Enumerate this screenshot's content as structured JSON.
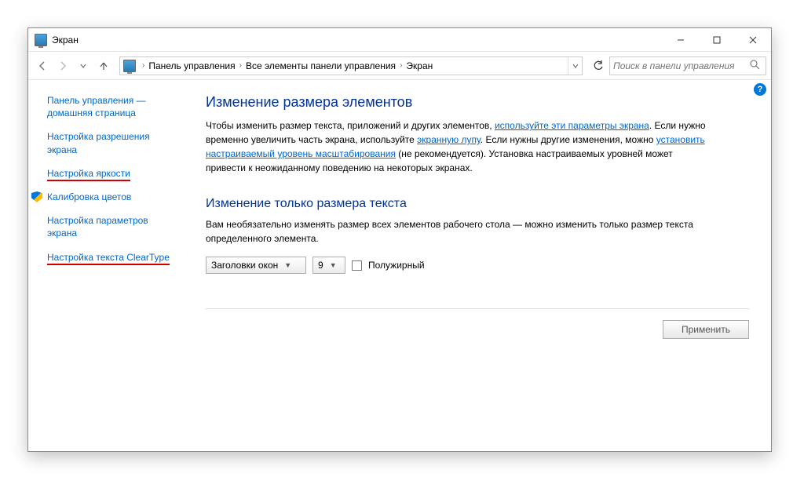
{
  "window": {
    "title": "Экран"
  },
  "breadcrumb": {
    "items": [
      "Панель управления",
      "Все элементы панели управления",
      "Экран"
    ]
  },
  "search": {
    "placeholder": "Поиск в панели управления"
  },
  "sidebar": {
    "home": "Панель управления — домашняя страница",
    "items": [
      {
        "label": "Настройка разрешения экрана",
        "underline": false,
        "shield": false
      },
      {
        "label": "Настройка яркости",
        "underline": true,
        "shield": false
      },
      {
        "label": "Калибровка цветов",
        "underline": false,
        "shield": true
      },
      {
        "label": "Настройка параметров экрана",
        "underline": false,
        "shield": false
      },
      {
        "label": "Настройка текста ClearType",
        "underline": true,
        "shield": false
      }
    ]
  },
  "main": {
    "heading1": "Изменение размера элементов",
    "p1_a": "Чтобы изменить размер текста, приложений и других элементов, ",
    "p1_link1": "используйте эти параметры экрана",
    "p1_b": ". Если нужно временно увеличить часть экрана, используйте ",
    "p1_link2": "экранную лупу",
    "p1_c": ". Если нужны другие изменения, можно ",
    "p1_link3": "установить настраиваемый уровень масштабирования",
    "p1_d": " (не рекомендуется). Установка настраиваемых уровней может привести к неожиданному поведению на некоторых экранах.",
    "heading2": "Изменение только размера текста",
    "p2": "Вам необязательно изменять размер всех элементов рабочего стола — можно изменить только размер текста определенного элемента.",
    "select_element": "Заголовки окон",
    "select_size": "9",
    "checkbox_label": "Полужирный",
    "apply": "Применить"
  },
  "help": "?"
}
